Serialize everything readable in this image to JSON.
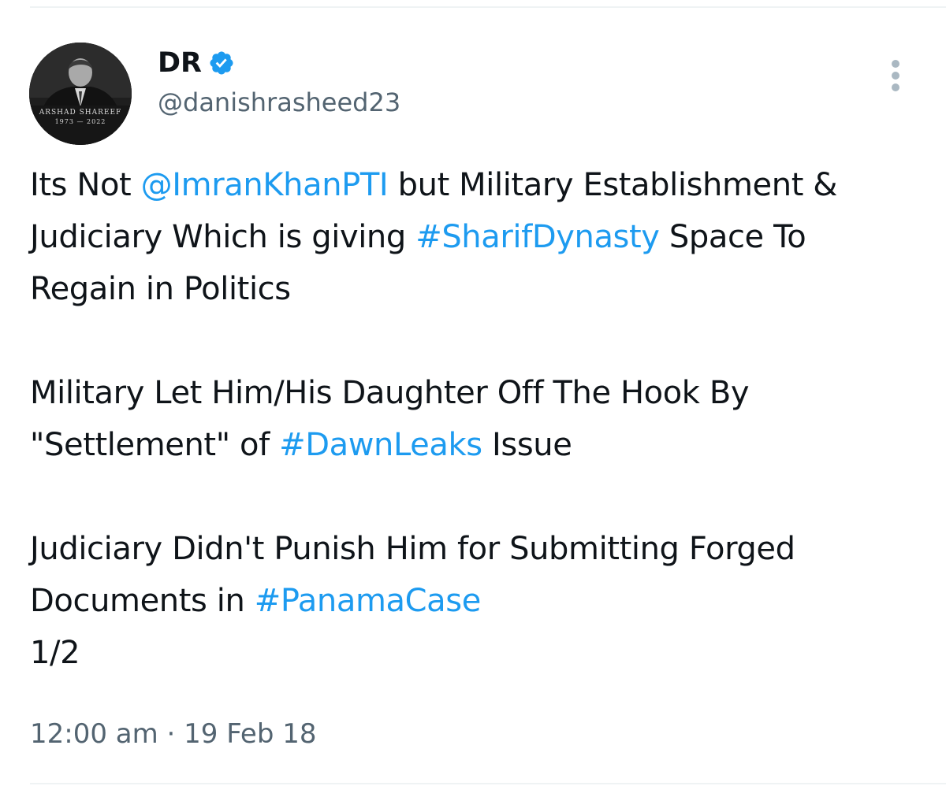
{
  "author": {
    "display_name": "DR",
    "handle": "@danishrasheed23",
    "avatar_caption_name": "ARSHAD SHAREEF",
    "avatar_caption_years": "1973 — 2022"
  },
  "tweet": {
    "p1": {
      "t1": "Its Not ",
      "mention": "@ImranKhanPTI",
      "t2": " but Military Establishment & Judiciary Which is giving ",
      "hashtag": "#SharifDynasty",
      "t3": " Space To Regain in Politics"
    },
    "p2": {
      "t1": "Military Let Him/His Daughter Off The Hook By \"Settlement\" of ",
      "hashtag": "#DawnLeaks",
      "t2": " Issue"
    },
    "p3": {
      "t1": "Judiciary Didn't Punish Him for Submitting Forged Documents in ",
      "hashtag": "#PanamaCase",
      "t2": "1/2"
    }
  },
  "timestamp": "12:00 am · 19 Feb 18",
  "colors": {
    "link": "#1d9bf0",
    "text": "#0f1419",
    "secondary": "#536471",
    "verified": "#1d9bf0"
  }
}
